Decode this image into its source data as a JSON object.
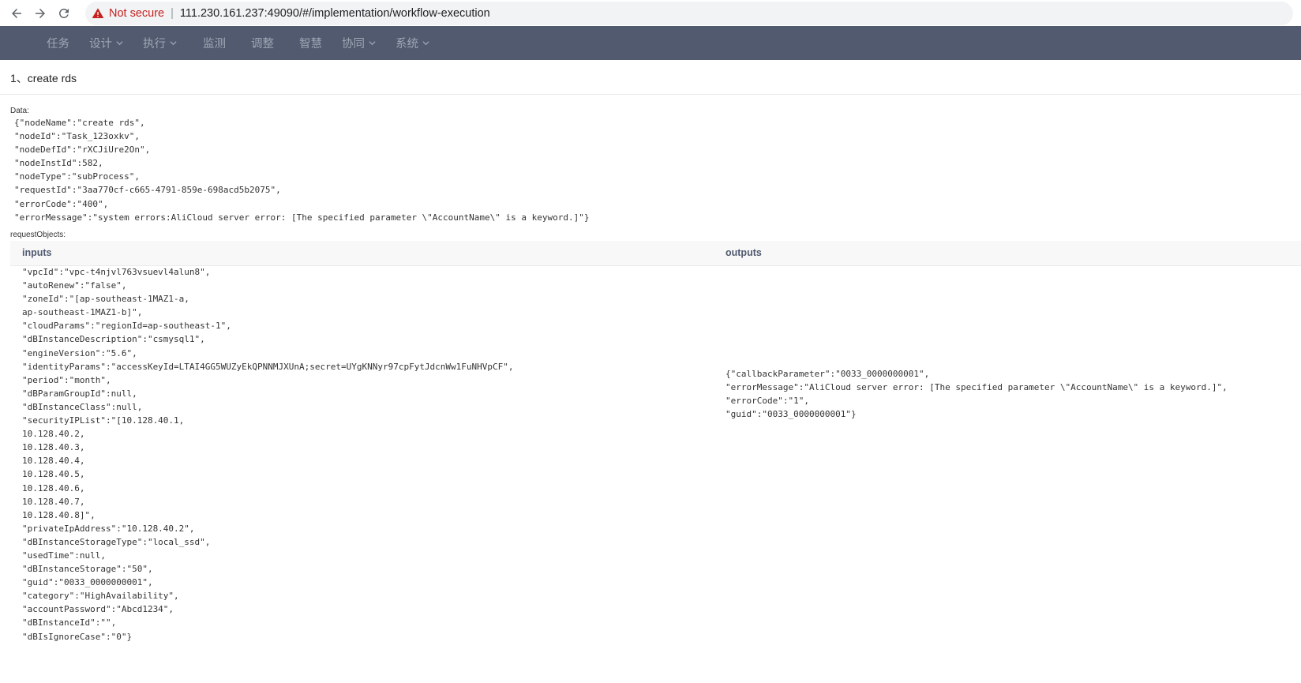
{
  "browser": {
    "security_label": "Not secure",
    "separator": "|",
    "url": "111.230.161.237:49090/#/implementation/workflow-execution"
  },
  "topnav": {
    "items": [
      {
        "label": "任务",
        "dropdown": false
      },
      {
        "label": "设计",
        "dropdown": true
      },
      {
        "label": "执行",
        "dropdown": true
      },
      {
        "label": "监测",
        "dropdown": false
      },
      {
        "label": "调整",
        "dropdown": false
      },
      {
        "label": "智慧",
        "dropdown": false
      },
      {
        "label": "协同",
        "dropdown": true
      },
      {
        "label": "系统",
        "dropdown": true
      }
    ]
  },
  "task": {
    "title": "1、create rds"
  },
  "data_section": {
    "label": "Data:",
    "lines": [
      "{\"nodeName\":\"create rds\",",
      "\"nodeId\":\"Task_123oxkv\",",
      "\"nodeDefId\":\"rXCJiUre2On\",",
      "\"nodeInstId\":582,",
      "\"nodeType\":\"subProcess\",",
      "\"requestId\":\"3aa770cf-c665-4791-859e-698acd5b2075\",",
      "\"errorCode\":\"400\",",
      "\"errorMessage\":\"system errors:AliCloud server error: [The specified parameter \\\"AccountName\\\" is a keyword.]\"}"
    ]
  },
  "request_objects": {
    "label": "requestObjects:",
    "columns": {
      "inputs": "inputs",
      "outputs": "outputs"
    },
    "inputs_lines": [
      "\"vpcId\":\"vpc-t4njvl763vsuevl4alun8\",",
      "\"autoRenew\":\"false\",",
      "\"zoneId\":\"[ap-southeast-1MAZ1-a,",
      "ap-southeast-1MAZ1-b]\",",
      "\"cloudParams\":\"regionId=ap-southeast-1\",",
      "\"dBInstanceDescription\":\"csmysql1\",",
      "\"engineVersion\":\"5.6\",",
      "\"identityParams\":\"accessKeyId=LTAI4GG5WUZyEkQPNNMJXUnA;secret=UYgKNNyr97cpFytJdcnWw1FuNHVpCF\",",
      "\"period\":\"month\",",
      "\"dBParamGroupId\":null,",
      "\"dBInstanceClass\":null,",
      "\"securityIPList\":\"[10.128.40.1,",
      "10.128.40.2,",
      "10.128.40.3,",
      "10.128.40.4,",
      "10.128.40.5,",
      "10.128.40.6,",
      "10.128.40.7,",
      "10.128.40.8]\",",
      "\"privateIpAddress\":\"10.128.40.2\",",
      "\"dBInstanceStorageType\":\"local_ssd\",",
      "\"usedTime\":null,",
      "\"dBInstanceStorage\":\"50\",",
      "\"guid\":\"0033_0000000001\",",
      "\"category\":\"HighAvailability\",",
      "\"accountPassword\":\"Abcd1234\",",
      "\"dBInstanceId\":\"\",",
      "\"dBIsIgnoreCase\":\"0\"}"
    ],
    "outputs_lines": [
      "{\"callbackParameter\":\"0033_0000000001\",",
      "\"errorMessage\":\"AliCloud server error: [The specified parameter \\\"AccountName\\\" is a keyword.]\",",
      "\"errorCode\":\"1\",",
      "\"guid\":\"0033_0000000001\"}"
    ]
  }
}
